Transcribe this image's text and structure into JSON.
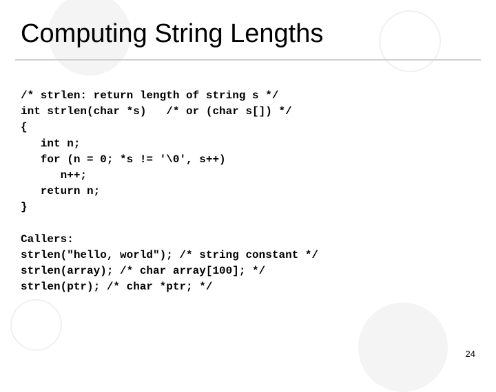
{
  "slide": {
    "title": "Computing String Lengths",
    "code_block": "/* strlen: return length of string s */\nint strlen(char *s)   /* or (char s[]) */\n{\n   int n;\n   for (n = 0; *s != '\\0', s++)\n      n++;\n   return n;\n}",
    "callers_heading": "Callers:",
    "callers_lines": [
      "strlen(\"hello, world\"); /* string constant */",
      "strlen(array); /* char array[100]; */",
      "strlen(ptr); /* char *ptr; */"
    ],
    "page_number": "24"
  }
}
